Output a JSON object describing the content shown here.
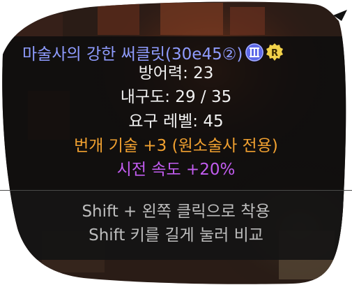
{
  "tooltip": {
    "item_name": "마술사의 강한 써클릿(30e45②)",
    "set_badge_icon": "roman-numeral-three-badge-icon",
    "rarity_badge_icon": "r-rarity-badge-icon",
    "rarity_badge_letter": "R",
    "stats": {
      "defense": "방어력: 23",
      "durability": "내구도: 29 / 35",
      "level_req": "요구 레벨: 45",
      "skill_bonus": "번개 기술 +3 (원소술사 전용)",
      "cast_speed": "시전 속도 +20%"
    },
    "hints": {
      "equip": "Shift + 왼쪽 클릭으로 착용",
      "compare": "Shift 키를 길게 눌러 비교"
    }
  },
  "colors": {
    "item_name": "#8f9cff",
    "stat_text": "#f2f2f2",
    "skill_bonus": "#f0a030",
    "cast_speed": "#c25cf0",
    "hint_text": "#bdbdbd",
    "tooltip_bg": "#111111",
    "rarity_badge": "#f2d24a",
    "set_badge": "#6a74f0"
  }
}
